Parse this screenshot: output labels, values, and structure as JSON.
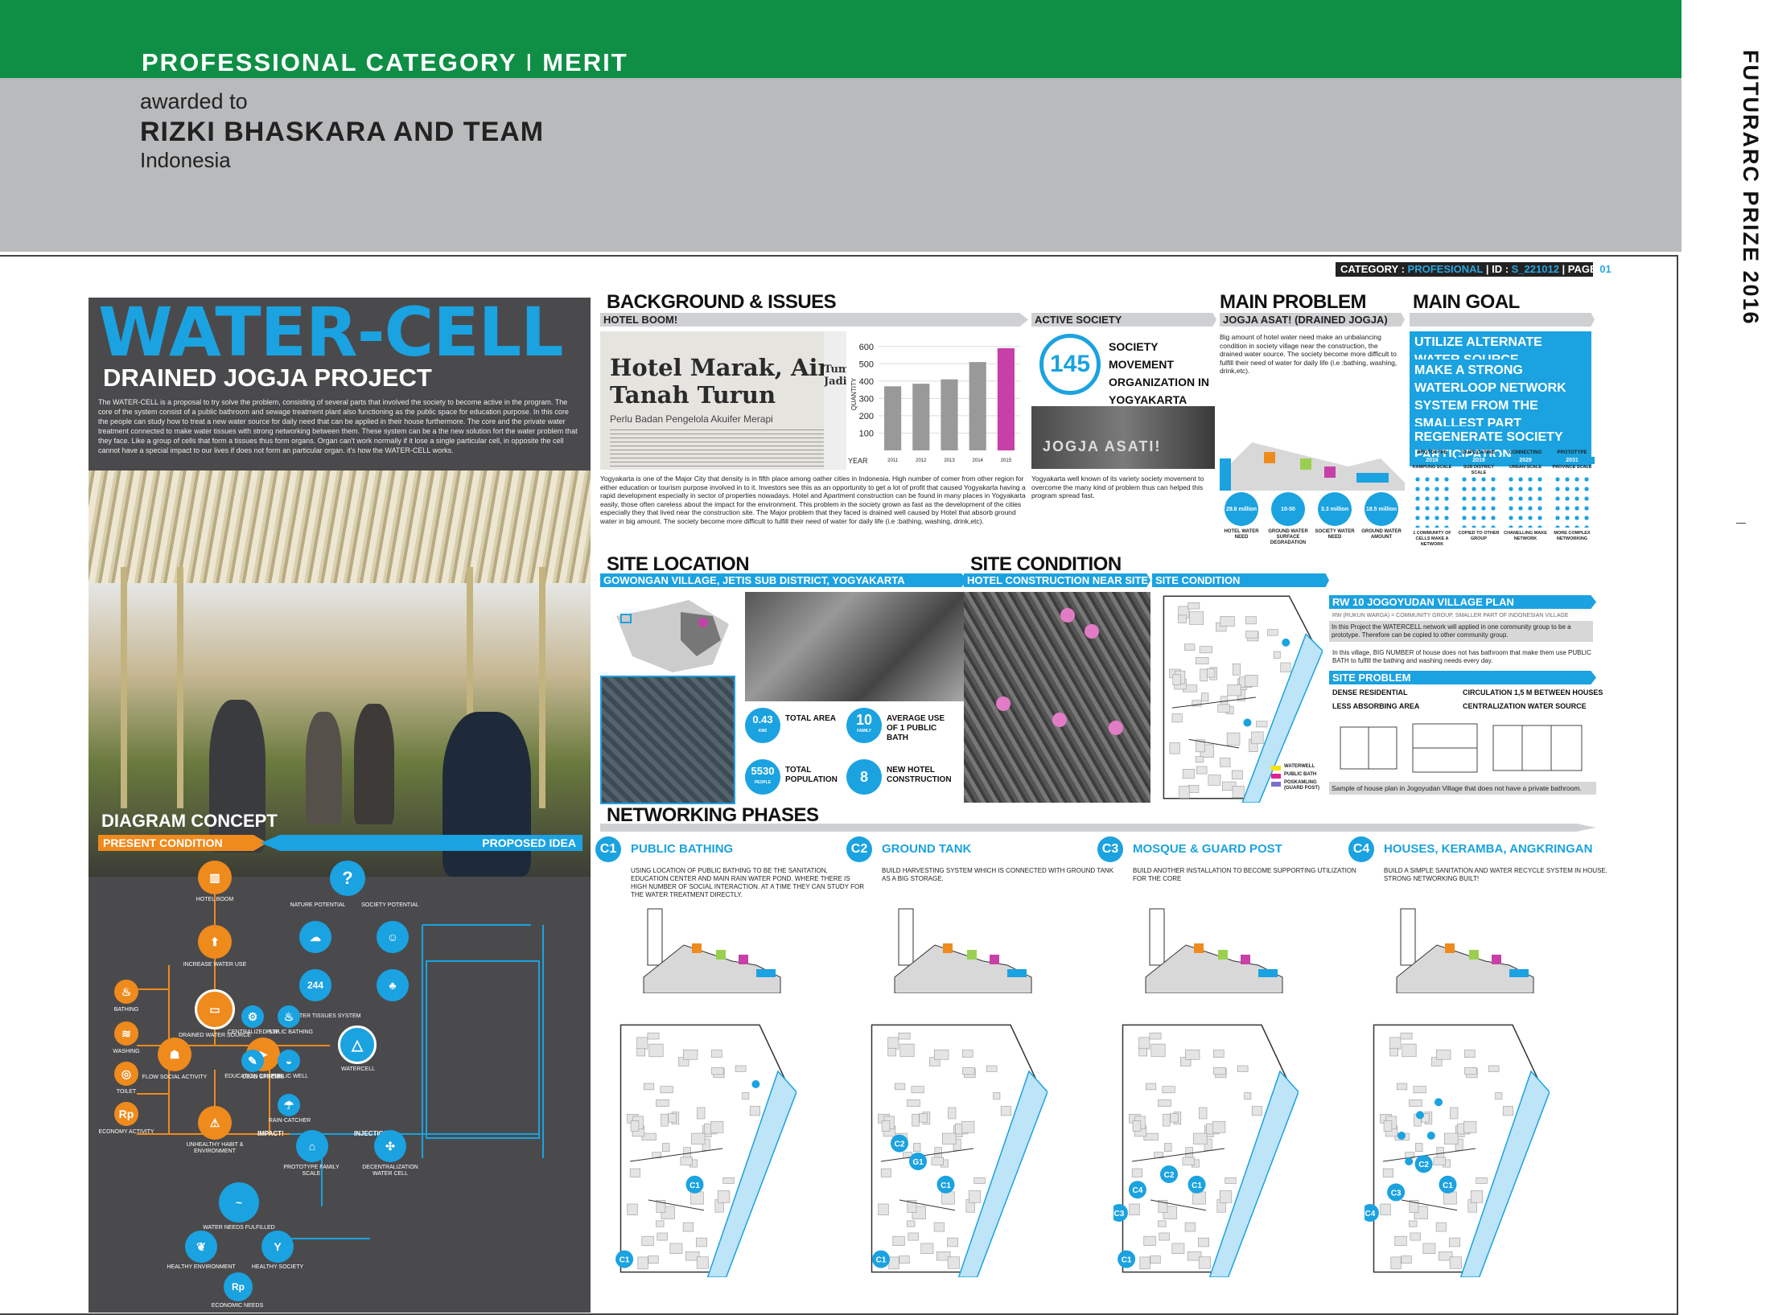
{
  "header": {
    "category": "PROFESSIONAL CATEGORY",
    "separator": "I",
    "merit": "MERIT",
    "awarded_to": "awarded to",
    "winner": "RIZKI BHASKARA AND TEAM",
    "country": "Indonesia",
    "side_title": "FUTURARC PRIZE 2016"
  },
  "idbar": {
    "category_label": "CATEGORY : ",
    "category_value": "PROFESIONAL",
    "id_label": " | ID : ",
    "id_value": "S_221012",
    "page_label": " | PAGE ",
    "page_value": "01"
  },
  "left": {
    "title": "WATER-CELL",
    "subtitle": "DRAINED JOGJA PROJECT",
    "intro": "The WATER-CELL is a proposal to try solve the problem, consisting of several parts that involved the society to become active in the program. The core of the system consist of a public bathroom and sewage treatment plant also functioning as the public space for education purpose. In this core the people can study how to treat a new water source for daily need that can be applied in their house furthermore. The core and the private water treatment connected to make water tissues with strong networking between them. These system can be a the new solution fort the water problem that they face. Like a group of cells that form a tissues thus form organs. Organ can't work normally if it lose a single particular cell, in opposite the cell cannot have a special impact to our lives if does not form an particular organ. it's how the WATER-CELL works.",
    "diagram_title": "DIAGRAM CONCEPT",
    "present": "PRESENT CONDITION",
    "proposed": "PROPOSED IDEA",
    "nodes": {
      "hotel_boom": "HOTEL BOOM",
      "increase_water": "INCREASE WATER USE",
      "drained_water": "DRAINED WATER SOURCE",
      "bathing": "BATHING",
      "washing": "WASHING",
      "toilet": "TOILET",
      "economy": "ECONOMY ACTIVITY",
      "rp": "Rp",
      "flow_social": "FLOW SOCIAL ACTIVITY",
      "dead_species": "DEAD SPECIES",
      "unhealthy": "UNHEALTHY HABIT & ENVIRONMENT",
      "impact": "IMPACT!",
      "injection": "INJECTION!",
      "nature_potential": "NATURE POTENTIAL",
      "society_potential": "SOCIETY POTENTIAL",
      "water_tissues": "WATER TISSUES SYSTEM",
      "centralized_stp": "CENTRALIZED STP",
      "public_bathing": "PUBLIC BATHING",
      "education_center": "EDUCATION CENTER",
      "public_well": "PUBLIC WELL",
      "rain_catcher": "RAIN-CATCHER",
      "watercell": "WATERCELL",
      "prototype": "PROTOTYPE FAMILY SCALE",
      "decentralization": "DECENTRALIZATION WATER CELL",
      "water_needs": "WATER NEEDS FULFILLED",
      "healthy_env": "HEALTHY ENVIRONMENT",
      "healthy_society": "HEALTHY SOCIETY",
      "economic_needs": "ECONOMIC NEEDS",
      "q": "?",
      "num244": "244"
    }
  },
  "background": {
    "title": "BACKGROUND & ISSUES",
    "bar": "HOTEL BOOM!",
    "news_headline": "Hotel Marak, Air Tanah Turun",
    "news_sub": "Perlu Badan Pengelola Akuifer Merapi",
    "news_side": "Tum Jadi",
    "text": "Yogyakarta is one of the Major City that density is in fifth place among oather cities in Indonesia. High number of comer from other region for either education or tourism purpose involved in to it. Investors see this as an opportunity to get a lot of profit that caused Yogyakarta having a rapid development especially in sector of properties nowadays. Hotel and Apartment construction can be found in many places in Yogyakarta easily, those often careless about the impact for the environment. This problem in the society grown as fast as the development of the cities especially they that lived near the construction site. The Major problem that they faced is drained well caused by Hotel that absorb ground water in big amount. The society become more difficult to fulfill their need of water for daily life (i.e :bathing, washing, drink,etc)."
  },
  "chart_data": {
    "type": "bar",
    "categories": [
      "2011",
      "2012",
      "2013",
      "2014",
      "2015"
    ],
    "values": [
      370,
      385,
      410,
      510,
      590
    ],
    "xlabel": "YEAR",
    "ylabel": "QUANTITY",
    "ylim": [
      0,
      650
    ],
    "yticks": [
      100,
      200,
      300,
      400,
      500,
      600
    ],
    "colors": [
      "#999999",
      "#999999",
      "#999999",
      "#999999",
      "#c640a8"
    ]
  },
  "active_society": {
    "bar": "ACTIVE SOCIETY",
    "number": "145",
    "label": "SOCIETY MOVEMENT ORGANIZATION IN YOGYAKARTA",
    "photo_text": "JOGJA ASATI!",
    "text": "Yogyakarta well known of its variety society movement to overcome the many kind of problem thus can helped this program spread fast."
  },
  "main_problem": {
    "title": "MAIN PROBLEM",
    "bar": "JOGJA ASAT! (DRAINED JOGJA)",
    "text": "Big amount of hotel water need make an unbalancing condition in society village near the construction, the drained water source. The society become more difficult to fulfill their need of water for daily life (i.e :bathing, washing, drink,etc).",
    "stats": [
      {
        "value": "29.6 million",
        "label": "HOTEL WATER NEED"
      },
      {
        "value": "10-50",
        "label": "GROUND WATER SURFACE DEGRADATION"
      },
      {
        "value": "3.3 million",
        "label": "SOCIETY WATER NEED"
      },
      {
        "value": "18.5 million",
        "label": "GROUND WATER AMOUNT"
      }
    ]
  },
  "main_goal": {
    "title": "MAIN GOAL",
    "goals": [
      "UTILIZE ALTERNATE WATER SOURCE",
      "MAKE A STRONG WATERLOOP NETWORK SYSTEM FROM THE SMALLEST PART",
      "REGENERATE SOCIETY PARTICIPATION"
    ],
    "timeline": [
      {
        "stage": "PROTOTYPE",
        "year": "2016",
        "scale": "KAMPUNG SCALE",
        "desc": "1 COMMUNITY OF CELLS MAKE A NETWORK"
      },
      {
        "stage": "DUPLICATING",
        "year": "2019",
        "scale": "SUB DISTRICT SCALE",
        "desc": "COPIED TO OTHER GROUP"
      },
      {
        "stage": "CONNECTING",
        "year": "2029",
        "scale": "URBAN SCALE",
        "desc": "CHANELLING MAKE NETWORK"
      },
      {
        "stage": "PROTOTYPE",
        "year": "2031",
        "scale": "PROVINCE SCALE",
        "desc": "MORE COMPLEX NETWORKING"
      }
    ]
  },
  "site_location": {
    "title": "SITE LOCATION",
    "bar": "GOWONGAN VILLAGE, JETIS SUB DISTRICT, YOGYAKARTA",
    "stats": [
      {
        "value": "0.43",
        "unit": "KM2",
        "label": "TOTAL AREA"
      },
      {
        "value": "10",
        "unit": "FAMILY",
        "label": "AVERAGE USE OF 1 PUBLIC BATH"
      },
      {
        "value": "5530",
        "unit": "PEOPLE",
        "label": "TOTAL POPULATION"
      },
      {
        "value": "8",
        "unit": "",
        "label": "NEW HOTEL CONSTRUCTION"
      }
    ]
  },
  "site_condition": {
    "title": "SITE CONDITION",
    "bar1": "HOTEL CONSTRUCTION NEAR SITE",
    "bar2": "SITE CONDITION",
    "legend": [
      {
        "label": "WATERWELL",
        "color": "#f4e300"
      },
      {
        "label": "PUBLIC BATH",
        "color": "#e0238c"
      },
      {
        "label": "POSKAMLING (GUARD POST)",
        "color": "#7a6fd0"
      }
    ]
  },
  "village_plan": {
    "bar": "RW 10 JOGOYUDAN VILLAGE PLAN",
    "sub": "RW (RUKUN WARGA) = COMMUNITY GROUP, SMALLER PART OF INDONESIAN VILLAGE",
    "text1": "In this Project the WATERCELL network will applied in one community group to be a prototype. Therefore can be copied to other community group.",
    "text2": "In this village, BIG NUMBER of house does not has bathroom that make them use PUBLIC BATH to fulfill the bathing and washing needs every day.",
    "problem_bar": "SITE PROBLEM",
    "problems": [
      "DENSE RESIDENTIAL",
      "CIRCULATION 1,5 M BETWEEN HOUSES",
      "LESS ABSORBING AREA",
      "CENTRALIZATION WATER SOURCE"
    ],
    "caption": "Sample of house plan in Jogoyudan Village that does not have a private bathroom."
  },
  "networking": {
    "title": "NETWORKING PHASES",
    "phases": [
      {
        "num": "C1",
        "title": "PUBLIC BATHING",
        "desc": "USING LOCATION OF PUBLIC BATHING TO BE THE SANITATION, EDUCATION CENTER AND MAIN RAIN WATER POND. WHERE THERE IS HIGH NUMBER OF SOCIAL INTERACTION. AT A TIME THEY CAN STUDY FOR THE WATER TREATMENT DIRECTLY."
      },
      {
        "num": "C2",
        "title": "GROUND TANK",
        "desc": "BUILD HARVESTING SYSTEM WHICH IS CONNECTED WITH GROUND TANK AS A BIG STORAGE."
      },
      {
        "num": "C3",
        "title": "MOSQUE & GUARD POST",
        "desc": "BUILD ANOTHER INSTALLATION TO BECOME SUPPORTING UTILIZATION FOR THE CORE"
      },
      {
        "num": "C4",
        "title": "HOUSES, KERAMBA, ANGKRINGAN",
        "desc": "BUILD A SIMPLE SANITATION AND WATER RECYCLE SYSTEM IN HOUSE. STRONG NETWORKING BUILT!"
      }
    ],
    "map_labels": {
      "c1": "C1",
      "c2": "C2",
      "c3": "C3",
      "c4": "C4",
      "g1": "G1"
    }
  },
  "colors": {
    "green": "#0e8f45",
    "gray": "#b9babc",
    "blue": "#1ba2e0",
    "orange": "#ef8a1d",
    "dark": "#4a4a4c"
  }
}
